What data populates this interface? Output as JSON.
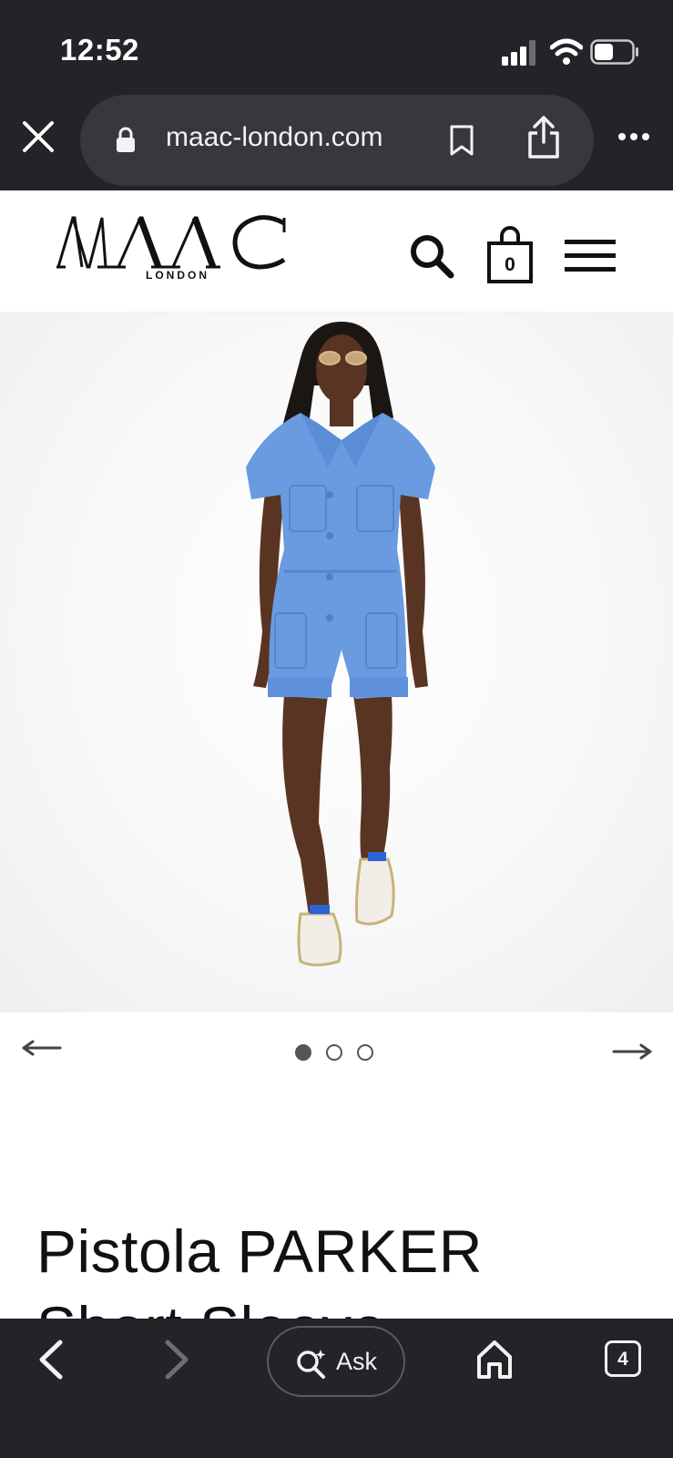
{
  "status_bar": {
    "time": "12:52"
  },
  "browser": {
    "url": "maac-london.com"
  },
  "site": {
    "logo_text": "MAAC",
    "logo_sub": "LONDON",
    "cart_count": "0"
  },
  "carousel": {
    "slide_count": 3,
    "active_index": 0
  },
  "product": {
    "title": "Pistola PARKER Short Sleeve"
  },
  "toolbar": {
    "ask_label": "Ask",
    "tab_count": "4"
  },
  "colors": {
    "chrome_bg": "#232428",
    "url_pill_bg": "#36383e",
    "garment_blue": "#6a9be0"
  }
}
